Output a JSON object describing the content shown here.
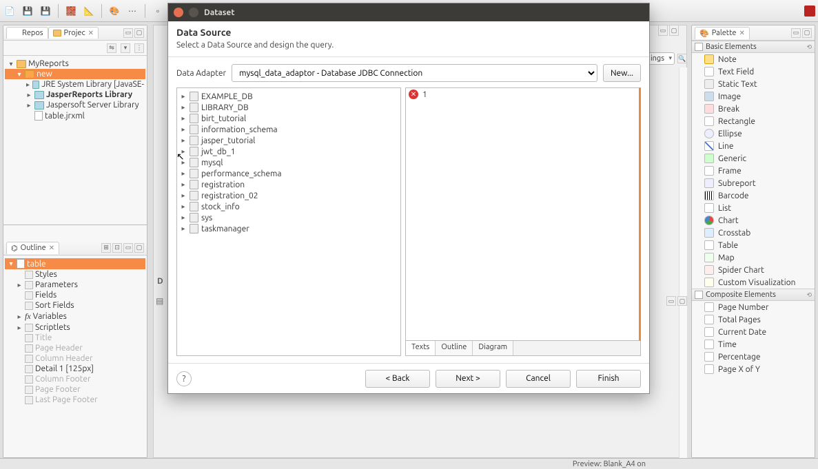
{
  "tabs": {
    "repos": "Repos",
    "project": "Projec",
    "outline": "Outline",
    "palette": "Palette"
  },
  "project_tree": {
    "root": "MyReports",
    "selected": "new",
    "children": [
      "JRE System Library [JavaSE-",
      "JasperReports Library",
      "Jaspersoft Server Library",
      "table.jrxml"
    ]
  },
  "outline": {
    "root": "table",
    "items": [
      {
        "label": "Styles",
        "dim": false
      },
      {
        "label": "Parameters",
        "dim": false
      },
      {
        "label": "Fields",
        "dim": false
      },
      {
        "label": "Sort Fields",
        "dim": false
      },
      {
        "label": "Variables",
        "dim": false,
        "prefix": "fx"
      },
      {
        "label": "Scriptlets",
        "dim": false
      },
      {
        "label": "Title",
        "dim": true
      },
      {
        "label": "Page Header",
        "dim": true
      },
      {
        "label": "Column Header",
        "dim": true
      },
      {
        "label": "Detail 1 [125px]",
        "dim": false
      },
      {
        "label": "Column Footer",
        "dim": true
      },
      {
        "label": "Page Footer",
        "dim": true
      },
      {
        "label": "Last Page Footer",
        "dim": true
      }
    ]
  },
  "mid": {
    "combo": "ings",
    "design_prefix": "D"
  },
  "palette": {
    "basic_header": "Basic Elements",
    "basic": [
      "Note",
      "Text Field",
      "Static Text",
      "Image",
      "Break",
      "Rectangle",
      "Ellipse",
      "Line",
      "Generic",
      "Frame",
      "Subreport",
      "Barcode",
      "List",
      "Chart",
      "Crosstab",
      "Table",
      "Map",
      "Spider Chart",
      "Custom Visualization"
    ],
    "composite_header": "Composite Elements",
    "composite": [
      "Page Number",
      "Total Pages",
      "Current Date",
      "Time",
      "Percentage",
      "Page X of Y"
    ]
  },
  "status": {
    "preview": "Preview: Blank_A4 on"
  },
  "dialog": {
    "title": "Dataset",
    "heading": "Data Source",
    "sub": "Select a Data Source and design the query.",
    "adapter_label": "Data Adapter",
    "adapter_value": "mysql_data_adaptor - Database JDBC Connection",
    "new_btn": "New...",
    "dbs": [
      "EXAMPLE_DB",
      "LIBRARY_DB",
      "birt_tutorial",
      "information_schema",
      "jasper_tutorial",
      "jwt_db_1",
      "mysql",
      "performance_schema",
      "registration",
      "registration_02",
      "stock_info",
      "sys",
      "taskmanager"
    ],
    "sql_line": "1",
    "tabs": [
      "Texts",
      "Outline",
      "Diagram"
    ],
    "help": "?",
    "back": "< Back",
    "next": "Next >",
    "cancel": "Cancel",
    "finish": "Finish"
  }
}
